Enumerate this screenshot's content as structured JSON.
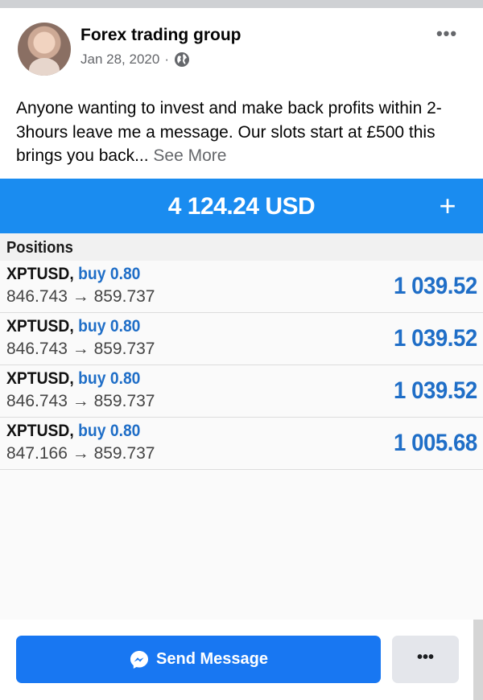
{
  "post": {
    "group_name": "Forex trading group",
    "date": "Jan 28, 2020",
    "separator": "·",
    "audience_icon": "globe-icon",
    "more_label": "•••",
    "text": "Anyone wanting to invest and make back profits within 2-3hours leave me a message. Our slots start at £500 this brings you back... ",
    "see_more": "See More"
  },
  "trading_screen": {
    "balance": "4 124.24 USD",
    "plus_label": "+",
    "section_title": "Positions",
    "positions": [
      {
        "symbol": "XPTUSD,",
        "side": "buy 0.80",
        "prices": "846.743 → 859.737",
        "profit": "1 039.52"
      },
      {
        "symbol": "XPTUSD,",
        "side": "buy 0.80",
        "prices": "846.743 → 859.737",
        "profit": "1 039.52"
      },
      {
        "symbol": "XPTUSD,",
        "side": "buy 0.80",
        "prices": "846.743 → 859.737",
        "profit": "1 039.52"
      },
      {
        "symbol": "XPTUSD,",
        "side": "buy 0.80",
        "prices": "847.166 → 859.737",
        "profit": "1 005.68"
      }
    ]
  },
  "actions": {
    "send_message_label": "Send Message",
    "send_icon": "messenger-icon",
    "more_label": "•••"
  },
  "colors": {
    "balance_bar": "#1a8cf0",
    "profit_blue": "#1f6ec7",
    "send_button": "#1877f2",
    "more_button": "#e4e6eb"
  }
}
